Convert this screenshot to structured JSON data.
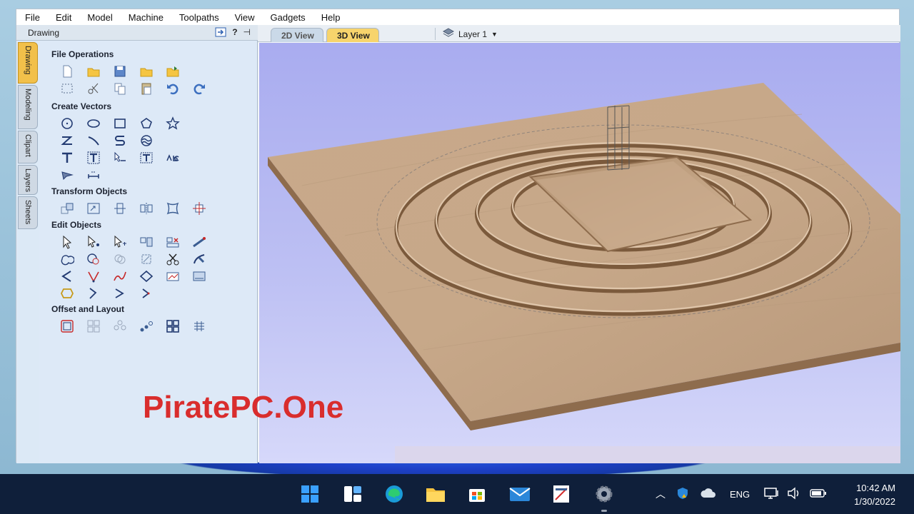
{
  "menu": [
    "File",
    "Edit",
    "Model",
    "Machine",
    "Toolpaths",
    "View",
    "Gadgets",
    "Help"
  ],
  "panel": {
    "title": "Drawing",
    "header_tools": [
      "?",
      "⊣"
    ],
    "vertical_tabs": [
      "Drawing",
      "Modeling",
      "Clipart",
      "Layers",
      "Sheets"
    ]
  },
  "sections": {
    "file_operations": "File Operations",
    "create_vectors": "Create Vectors",
    "transform_objects": "Transform Objects",
    "edit_objects": "Edit Objects",
    "offset_layout": "Offset and Layout"
  },
  "view": {
    "tab_2d": "2D View",
    "tab_3d": "3D View",
    "layer": "Layer 1"
  },
  "watermark": "PiratePC.One",
  "taskbar": {
    "lang": "ENG",
    "time": "10:42 AM",
    "date": "1/30/2022"
  }
}
